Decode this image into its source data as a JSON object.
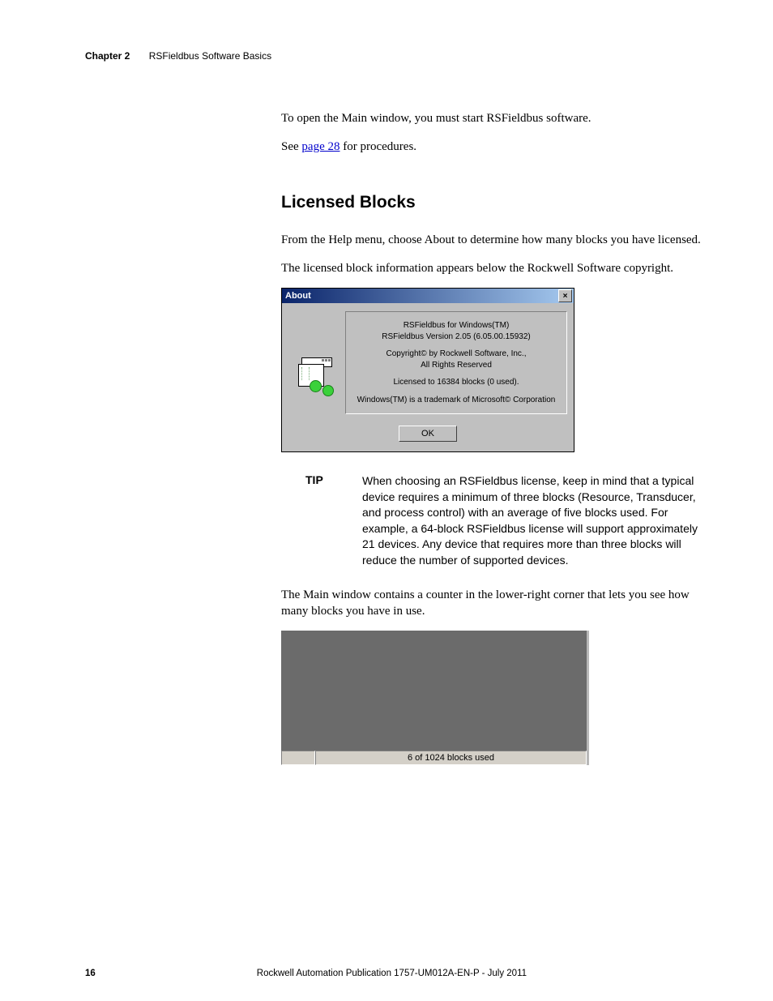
{
  "header": {
    "chapter": "Chapter 2",
    "title": "RSFieldbus Software Basics"
  },
  "intro": {
    "p1": "To open the Main window, you must start RSFieldbus software.",
    "p2_a": "See ",
    "p2_link": "page 28",
    "p2_b": " for procedures."
  },
  "section_heading": "Licensed Blocks",
  "body": {
    "p1": "From the Help menu, choose About to determine how many blocks you have licensed.",
    "p2": "The licensed block information appears below the Rockwell Software copyright."
  },
  "about_dialog": {
    "title": "About",
    "close": "×",
    "line1": "RSFieldbus for Windows(TM)",
    "line2": "RSFieldbus Version 2.05 (6.05.00.15932)",
    "line3": "Copyright© by Rockwell Software, Inc.,",
    "line4": "All Rights Reserved",
    "line5": "Licensed to 16384 blocks (0 used).",
    "line6": "Windows(TM) is a trademark of Microsoft© Corporation",
    "ok": "OK"
  },
  "tip": {
    "label": "TIP",
    "text": "When choosing an RSFieldbus license, keep in mind that a typical device requires a minimum of three blocks (Resource, Transducer, and process control) with an average of five blocks used. For example, a 64-block RSFieldbus license will support approximately 21 devices. Any device that requires more than three blocks will reduce the number of supported devices."
  },
  "counter_para": "The Main window contains a counter in the lower-right corner that lets you see how many blocks you have in use.",
  "status_bar": {
    "text": "6 of 1024 blocks used"
  },
  "footer": {
    "page_num": "16",
    "publication": "Rockwell Automation Publication 1757-UM012A-EN-P - July 2011"
  }
}
